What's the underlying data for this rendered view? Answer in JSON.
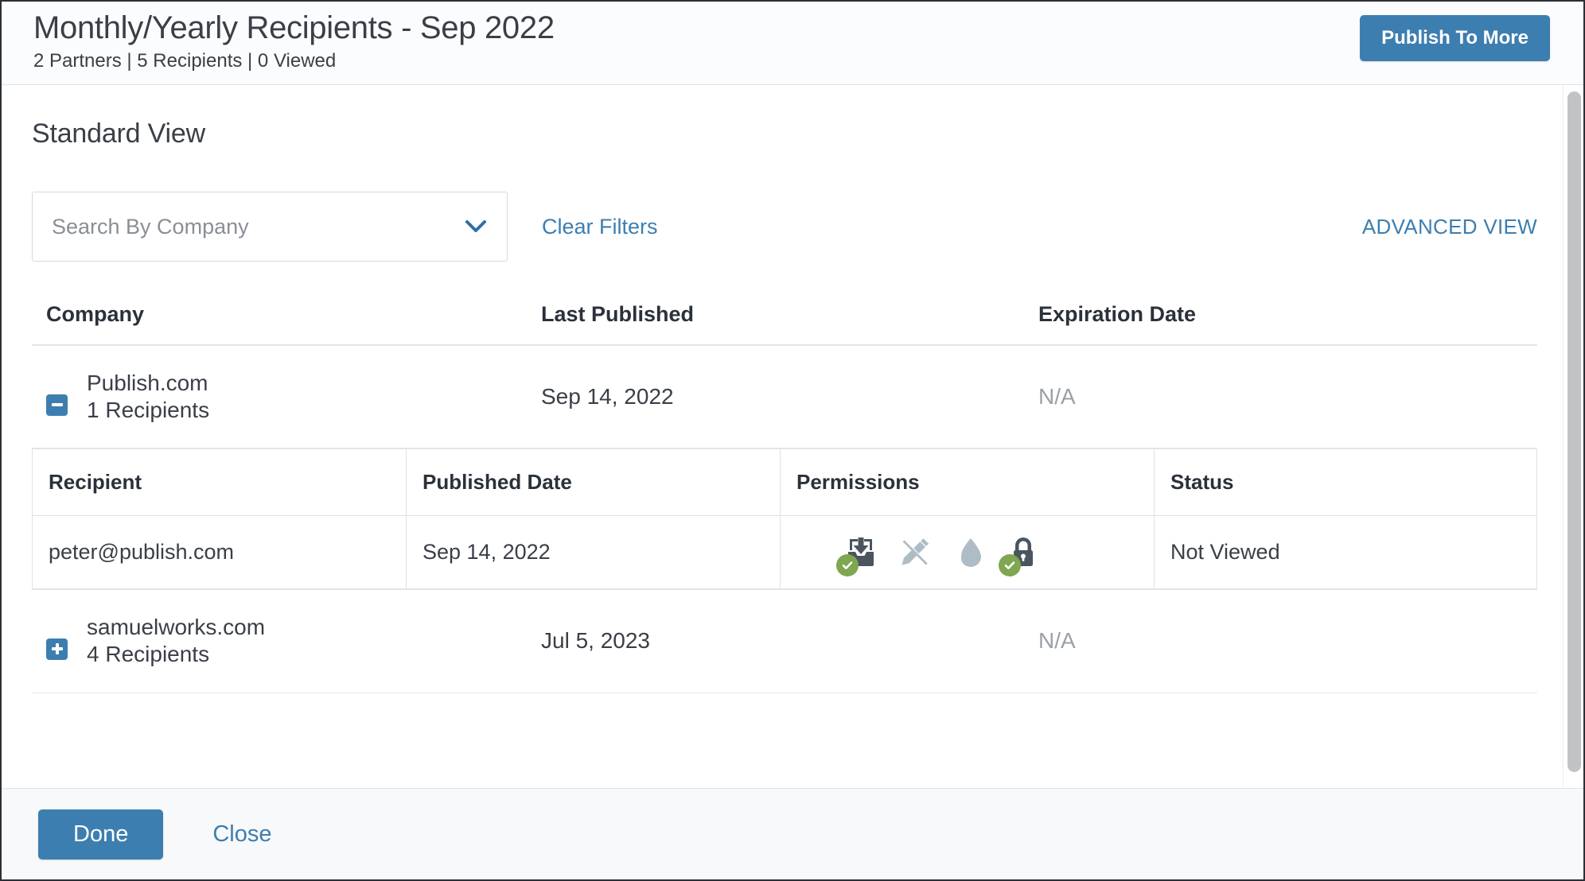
{
  "header": {
    "title": "Monthly/Yearly Recipients - Sep 2022",
    "subtitle": "2 Partners | 5 Recipients | 0 Viewed",
    "publish_button": "Publish To More"
  },
  "section": {
    "title": "Standard View"
  },
  "filters": {
    "search_placeholder": "Search By Company",
    "search_value": "",
    "chevron_icon": "chevron-down-icon",
    "clear_filters": "Clear Filters",
    "advanced_view": "ADVANCED VIEW"
  },
  "outer_table": {
    "columns": [
      "Company",
      "Last Published",
      "Expiration Date"
    ],
    "rows": [
      {
        "toggle_icon": "minus-square-icon",
        "expanded": true,
        "company": "Publish.com",
        "recipients_count": "1 Recipients",
        "last_published": "Sep 14, 2022",
        "expiration_date": "N/A"
      },
      {
        "toggle_icon": "plus-square-icon",
        "expanded": false,
        "company": "samuelworks.com",
        "recipients_count": "4 Recipients",
        "last_published": "Jul 5, 2023",
        "expiration_date": "N/A"
      }
    ]
  },
  "nested_table": {
    "columns": [
      "Recipient",
      "Published Date",
      "Permissions",
      "Status"
    ],
    "rows": [
      {
        "recipient": "peter@publish.com",
        "published_date": "Sep 14, 2022",
        "status": "Not Viewed",
        "permissions": [
          {
            "name": "download-icon",
            "label": "Download",
            "enabled": true
          },
          {
            "name": "markup-icon",
            "label": "Markup",
            "enabled": false
          },
          {
            "name": "watermark-icon",
            "label": "Watermark",
            "enabled": false
          },
          {
            "name": "lock-icon",
            "label": "Secured",
            "enabled": true
          }
        ]
      }
    ]
  },
  "footer": {
    "done_label": "Done",
    "close_label": "Close"
  },
  "colors": {
    "accent_blue": "#3d7eb0",
    "link_blue": "#3d7eb0",
    "check_green": "#7fa650",
    "icon_dark": "#4a555f",
    "icon_disabled": "#aebcc6",
    "text_dark": "#3a3f47",
    "muted": "#9aa0a6"
  }
}
